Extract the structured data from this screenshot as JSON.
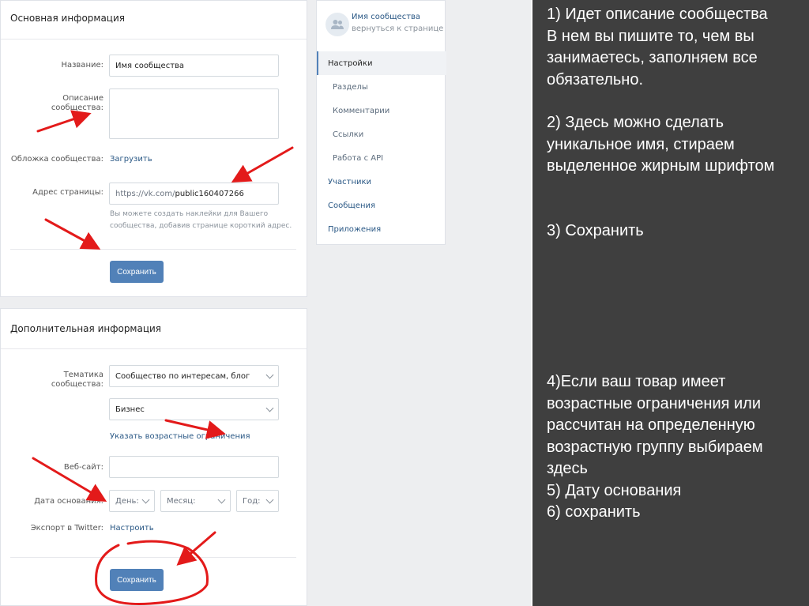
{
  "basic": {
    "title": "Основная информация",
    "name_label": "Название:",
    "name_value": "Имя сообщества",
    "description_label": "Описание сообщества:",
    "description_value": "",
    "cover_label": "Обложка сообщества:",
    "cover_link": "Загрузить",
    "address_label": "Адрес страницы:",
    "address_prefix": "https://vk.com/",
    "address_value": "public160407266",
    "address_hint": "Вы можете создать наклейки для Вашего сообщества, добавив странице короткий адрес.",
    "save": "Сохранить"
  },
  "extra": {
    "title": "Дополнительная информация",
    "topic_label": "Тематика сообщества:",
    "topic_value": "Сообщество по интересам, блог",
    "subtopic_value": "Бизнес",
    "age_link": "Указать возрастные ограничения",
    "website_label": "Веб-сайт:",
    "website_value": "",
    "founded_label": "Дата основания:",
    "day": "День:",
    "month": "Месяц:",
    "year": "Год:",
    "twitter_label": "Экспорт в Twitter:",
    "twitter_link": "Настроить",
    "save": "Сохранить"
  },
  "sidebar": {
    "community_name": "Имя сообщества",
    "back_link": "вернуться к странице",
    "items": [
      {
        "label": "Настройки"
      },
      {
        "label": "Разделы"
      },
      {
        "label": "Комментарии"
      },
      {
        "label": "Ссылки"
      },
      {
        "label": "Работа с API"
      },
      {
        "label": "Участники"
      },
      {
        "label": "Сообщения"
      },
      {
        "label": "Приложения"
      }
    ]
  },
  "notes": {
    "block1": "1) Идет описание сообщества\nВ нем вы пишите то, чем вы занимаетесь, заполняем все обязательно.",
    "block2": "2) Здесь можно сделать уникальное имя, стираем выделенное жирным шрифтом",
    "block3": "3) Сохранить",
    "block4": "4)Если ваш товар имеет возрастные ограничения или рассчитан на определенную возрастную группу выбираем здесь\n5) Дату основания\n6) сохранить"
  },
  "colors": {
    "accent": "#5181b8",
    "link": "#2a5885",
    "annotation": "#e31a1a",
    "notes_bg": "#3f3f3f"
  }
}
